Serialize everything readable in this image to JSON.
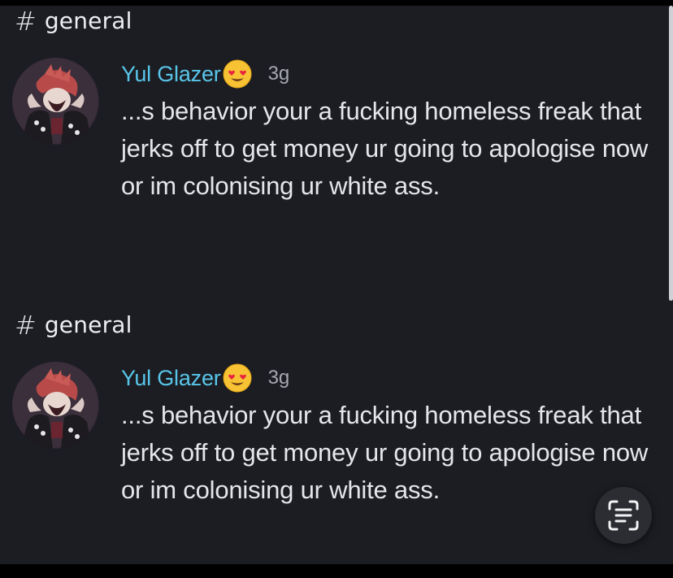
{
  "colors": {
    "background": "#1c1d22",
    "author": "#58c6ea",
    "message_text": "#e4e6ea",
    "timestamp": "#a6a8b0"
  },
  "results": [
    {
      "channel": {
        "hash": "#",
        "name": "general"
      },
      "message": {
        "author": "Yul Glazer",
        "author_emoji": "heart-eyes-emoji",
        "timestamp": "3g",
        "text": "...s behavior your a fucking homeless freak that jerks off to get money ur going to apologise now or im colonising ur white ass."
      }
    },
    {
      "channel": {
        "hash": "#",
        "name": "general"
      },
      "message": {
        "author": "Yul Glazer",
        "author_emoji": "heart-eyes-emoji",
        "timestamp": "3g",
        "text": "...s behavior your a fucking homeless freak that jerks off to get money ur going to apologise now or im colonising ur white ass."
      }
    }
  ],
  "overlay": {
    "icon": "text-scan-icon"
  }
}
